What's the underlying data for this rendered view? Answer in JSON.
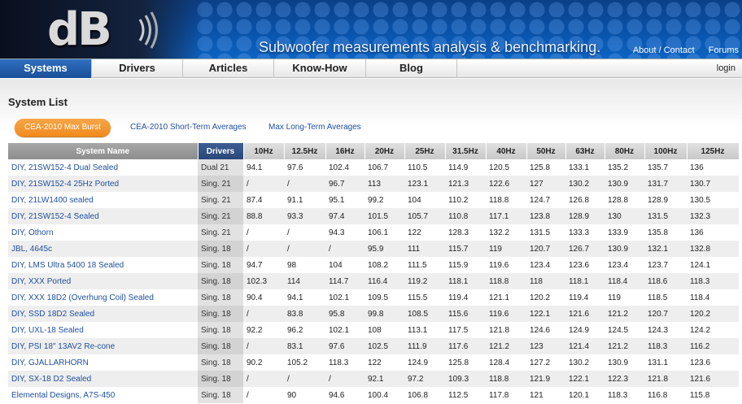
{
  "header": {
    "logo_text": "dB",
    "tagline": "Subwoofer measurements analysis & benchmarking.",
    "links": [
      "About / Contact",
      "Forums"
    ]
  },
  "nav": {
    "items": [
      "Systems",
      "Drivers",
      "Articles",
      "Know-How",
      "Blog"
    ],
    "active": "Systems",
    "login": "login"
  },
  "page_title": "System List",
  "tabs": [
    "CEA-2010 Max Burst",
    "CEA-2010 Short-Term Averages",
    "Max Long-Term Averages"
  ],
  "table": {
    "headers": [
      "System Name",
      "Drivers",
      "10Hz",
      "12.5Hz",
      "16Hz",
      "20Hz",
      "25Hz",
      "31.5Hz",
      "40Hz",
      "50Hz",
      "63Hz",
      "80Hz",
      "100Hz",
      "125Hz"
    ],
    "rows": [
      [
        "DIY, 21SW152-4 Dual Sealed",
        "Dual 21",
        "94.1",
        "97.6",
        "102.4",
        "106.7",
        "110.5",
        "114.9",
        "120.5",
        "125.8",
        "133.1",
        "135.2",
        "135.7",
        "136"
      ],
      [
        "DIY, 21SW152-4 25Hz Ported",
        "Sing. 21",
        "/",
        "/",
        "96.7",
        "113",
        "123.1",
        "121.3",
        "122.6",
        "127",
        "130.2",
        "130.9",
        "131.7",
        "130.7"
      ],
      [
        "DIY, 21LW1400 sealed",
        "Sing. 21",
        "87.4",
        "91.1",
        "95.1",
        "99.2",
        "104",
        "110.2",
        "118.8",
        "124.7",
        "126.8",
        "128.8",
        "128.9",
        "130.5"
      ],
      [
        "DIY, 21SW152-4 Sealed",
        "Sing. 21",
        "88.8",
        "93.3",
        "97.4",
        "101.5",
        "105.7",
        "110.8",
        "117.1",
        "123.8",
        "128.9",
        "130",
        "131.5",
        "132.3"
      ],
      [
        "DIY, Othorn",
        "Sing. 21",
        "/",
        "/",
        "94.3",
        "106.1",
        "122",
        "128.3",
        "132.2",
        "131.5",
        "133.3",
        "133.9",
        "135.8",
        "136"
      ],
      [
        "JBL, 4645c",
        "Sing. 18",
        "/",
        "/",
        "/",
        "95.9",
        "111",
        "115.7",
        "119",
        "120.7",
        "126.7",
        "130.9",
        "132.1",
        "132.8"
      ],
      [
        "DIY, LMS Ultra 5400 18 Sealed",
        "Sing. 18",
        "94.7",
        "98",
        "104",
        "108.2",
        "111.5",
        "115.9",
        "119.6",
        "123.4",
        "123.6",
        "123.4",
        "123.7",
        "124.1"
      ],
      [
        "DIY, XXX Ported",
        "Sing. 18",
        "102.3",
        "114",
        "114.7",
        "116.4",
        "119.2",
        "118.1",
        "118.8",
        "118",
        "118.1",
        "118.4",
        "118.6",
        "118.3"
      ],
      [
        "DIY, XXX 18D2 (Overhung Coil) Sealed",
        "Sing. 18",
        "90.4",
        "94.1",
        "102.1",
        "109.5",
        "115.5",
        "119.4",
        "121.1",
        "120.2",
        "119.4",
        "119",
        "118.5",
        "118.4"
      ],
      [
        "DIY, SSD 18D2 Sealed",
        "Sing. 18",
        "/",
        "83.8",
        "95.8",
        "99.8",
        "108.5",
        "115.6",
        "119.6",
        "122.1",
        "121.6",
        "121.2",
        "120.7",
        "120.2"
      ],
      [
        "DIY, UXL-18 Sealed",
        "Sing. 18",
        "92.2",
        "96.2",
        "102.1",
        "108",
        "113.1",
        "117.5",
        "121.8",
        "124.6",
        "124.9",
        "124.5",
        "124.3",
        "124.2"
      ],
      [
        "DIY, PSI 18\" 13AV2 Re-cone",
        "Sing. 18",
        "/",
        "83.1",
        "97.6",
        "102.5",
        "111.9",
        "117.6",
        "121.2",
        "123",
        "121.4",
        "121.2",
        "118.3",
        "116.2"
      ],
      [
        "DIY, GJALLARHORN",
        "Sing. 18",
        "90.2",
        "105.2",
        "118.3",
        "122",
        "124.9",
        "125.8",
        "128.4",
        "127.2",
        "130.2",
        "130.9",
        "131.1",
        "123.6"
      ],
      [
        "DIY, SX-18 D2 Sealed",
        "Sing. 18",
        "/",
        "/",
        "/",
        "92.1",
        "97.2",
        "109.3",
        "118.8",
        "121.9",
        "122.1",
        "122.3",
        "121.8",
        "121.6"
      ],
      [
        "Elemental Designs, A7S-450",
        "Sing. 18",
        "/",
        "90",
        "94.6",
        "100.4",
        "106.8",
        "112.5",
        "117.8",
        "121",
        "120.1",
        "118.3",
        "116.8",
        "115.8"
      ]
    ]
  }
}
